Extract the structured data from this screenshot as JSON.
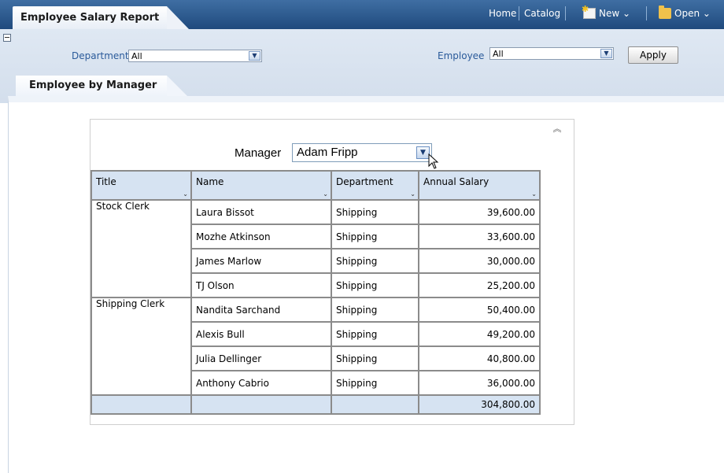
{
  "header": {
    "report_title": "Employee Salary Report",
    "nav": {
      "home": "Home",
      "catalog": "Catalog",
      "new": "New",
      "open": "Open"
    }
  },
  "prompts": {
    "department": {
      "label": "Department",
      "value": "All"
    },
    "employee": {
      "label": "Employee",
      "value": "All"
    },
    "apply_label": "Apply"
  },
  "page_tab": "Employee by Manager",
  "view": {
    "manager_label": "Manager",
    "manager_value": "Adam Fripp"
  },
  "table": {
    "columns": [
      "Title",
      "Name",
      "Department",
      "Annual Salary"
    ],
    "groups": [
      {
        "title": "Stock Clerk",
        "rows": [
          {
            "name": "Laura Bissot",
            "department": "Shipping",
            "salary": "39,600.00"
          },
          {
            "name": "Mozhe Atkinson",
            "department": "Shipping",
            "salary": "33,600.00"
          },
          {
            "name": "James Marlow",
            "department": "Shipping",
            "salary": "30,000.00"
          },
          {
            "name": "TJ Olson",
            "department": "Shipping",
            "salary": "25,200.00"
          }
        ]
      },
      {
        "title": "Shipping Clerk",
        "rows": [
          {
            "name": "Nandita Sarchand",
            "department": "Shipping",
            "salary": "50,400.00"
          },
          {
            "name": "Alexis Bull",
            "department": "Shipping",
            "salary": "49,200.00"
          },
          {
            "name": "Julia Dellinger",
            "department": "Shipping",
            "salary": "40,800.00"
          },
          {
            "name": "Anthony Cabrio",
            "department": "Shipping",
            "salary": "36,000.00"
          }
        ]
      }
    ],
    "total": "304,800.00"
  },
  "icons": {
    "dropdown": "chevron-down-icon",
    "collapse_view": "double-chevron-up-icon",
    "new": "new-document-icon",
    "open": "folder-icon",
    "cursor": "mouse-pointer-icon"
  }
}
